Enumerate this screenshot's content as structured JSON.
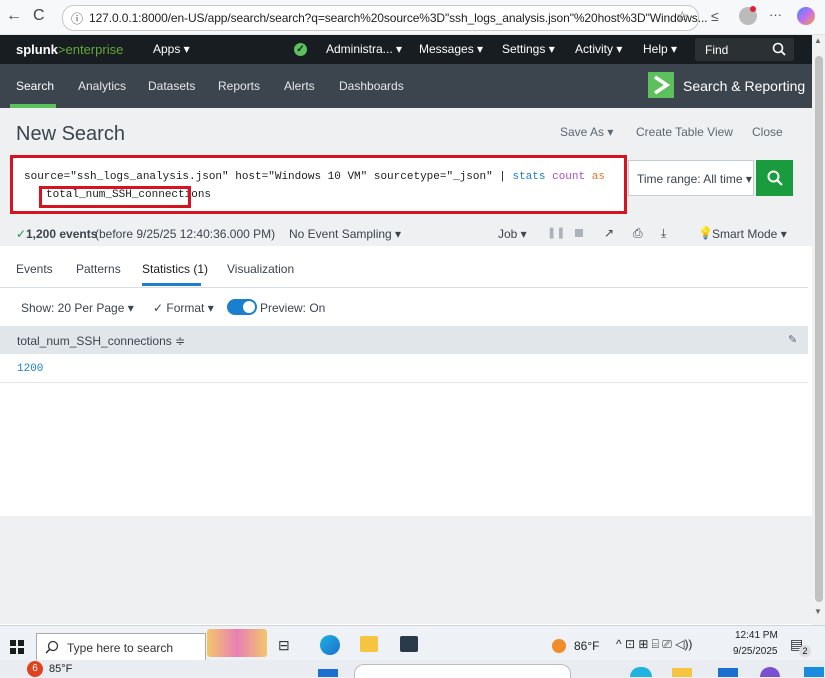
{
  "browser": {
    "back_icon": "←",
    "reload_icon": "C",
    "info_icon": "ⓘ",
    "url": "127.0.0.1:8000/en-US/app/search/search?q=search%20source%3D\"ssh_logs_analysis.json\"%20host%3D\"Windows..."
  },
  "topbar": {
    "logo_bold": "splunk",
    "logo_light": ">enterprise",
    "apps": "Apps ▾",
    "admin": "Administra... ▾",
    "messages": "Messages ▾",
    "settings": "Settings ▾",
    "activity": "Activity ▾",
    "help": "Help ▾",
    "find": "Find"
  },
  "appbar": {
    "tabs": [
      "Search",
      "Analytics",
      "Datasets",
      "Reports",
      "Alerts",
      "Dashboards"
    ],
    "app_title": "Search & Reporting"
  },
  "page": {
    "title": "New Search",
    "save_as": "Save As ▾",
    "create_table_view": "Create Table View",
    "close": "Close"
  },
  "query": {
    "line1_plain": "source=\"ssh_logs_analysis.json\" host=\"Windows 10 VM\" sourcetype=\"_json\" | ",
    "cmd": "stats",
    "fn": "count",
    "kw": "as",
    "line2": "total_num_SSH_connections"
  },
  "time_range": "Time range: All time ▾",
  "status": {
    "check": "✓",
    "events_bold": "1,200 events",
    "events_rest": "(before 9/25/25 12:40:36.000 PM)",
    "sampling": "No Event Sampling ▾",
    "job": "Job ▾",
    "smart_mode": "Smart Mode ▾"
  },
  "tabs": [
    "Events",
    "Patterns",
    "Statistics (1)",
    "Visualization"
  ],
  "options": {
    "per_page": "Show: 20 Per Page ▾",
    "format": "✓ Format ▾",
    "preview": "Preview: On"
  },
  "table": {
    "column": "total_num_SSH_connections ≑",
    "rows": [
      "1200"
    ]
  },
  "taskbar": {
    "search_placeholder": "Type here to search",
    "temperature": "86°F",
    "time": "12:41 PM",
    "date": "9/25/2025",
    "weather_badge": "6",
    "weather_temp": "85°F",
    "notif_count": "2"
  },
  "colors": {
    "accent_green": "#1a9c3e",
    "highlight_red": "#d6131f",
    "toggle_blue": "#1a7fcf"
  }
}
